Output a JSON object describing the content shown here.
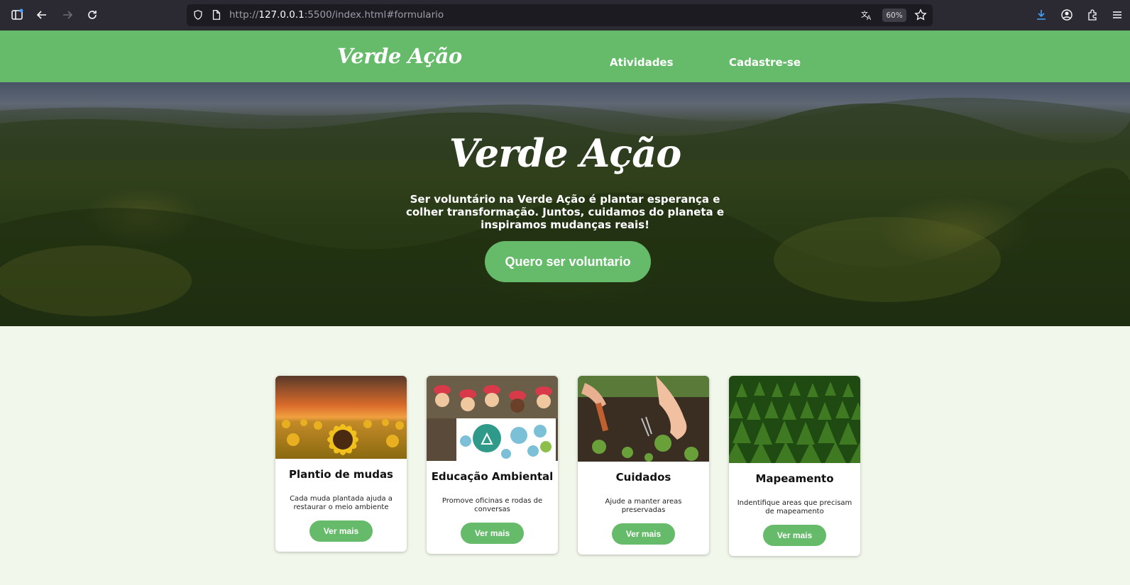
{
  "browser": {
    "url_prefix": "http://",
    "url_host": "127.0.0.1",
    "url_rest": ":5500/index.html#formulario",
    "zoom": "60%"
  },
  "header": {
    "logo": "Verde Ação",
    "nav": [
      {
        "label": "Atividades"
      },
      {
        "label": "Cadastre-se"
      }
    ]
  },
  "hero": {
    "title": "Verde Ação",
    "text": "Ser voluntário na Verde Ação é plantar esperança e colher transformação. Juntos, cuidamos do planeta e inspiramos mudanças reais!",
    "cta": "Quero ser voluntario"
  },
  "cards": [
    {
      "title": "Plantio de mudas",
      "description": "Cada muda plantada ajuda a restaurar o meio ambiente",
      "button": "Ver mais",
      "image": "sunflower-field"
    },
    {
      "title": "Educação Ambiental",
      "description": "Promove oficinas e rodas de conversas",
      "button": "Ver mais",
      "image": "children-recycling"
    },
    {
      "title": "Cuidados",
      "description": "Ajude a manter areas preservadas",
      "button": "Ver mais",
      "image": "hands-gardening"
    },
    {
      "title": "Mapeamento",
      "description": "Indentifique areas que precisam de mapeamento",
      "button": "Ver mais",
      "image": "pine-forest"
    }
  ],
  "colors": {
    "brand_green": "#66bb6a",
    "page_bg": "#f1f7ea"
  }
}
